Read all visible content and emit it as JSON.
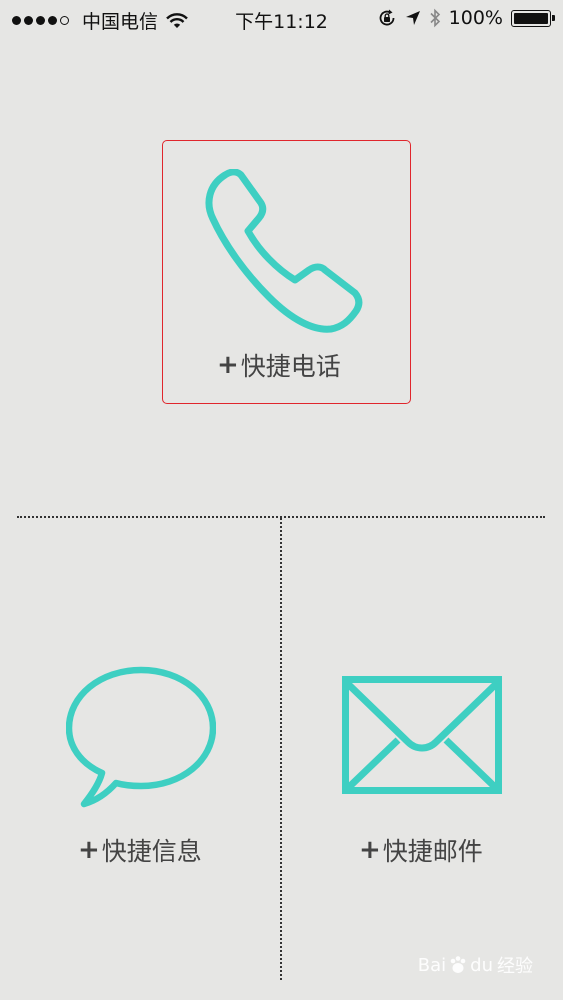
{
  "status_bar": {
    "carrier": "中国电信",
    "time": "下午11:12",
    "battery": "100%",
    "signal_bars": 4,
    "signal_total": 5,
    "battery_level": 1.0,
    "icons": [
      "wifi-icon",
      "rotation-lock-icon",
      "location-arrow-icon",
      "bluetooth-icon",
      "battery-icon"
    ]
  },
  "tiles": {
    "call": {
      "plus": "+",
      "label": "快捷电话",
      "icon": "phone-handset-icon"
    },
    "message": {
      "plus": "+",
      "label": "快捷信息",
      "icon": "speech-bubble-icon"
    },
    "mail": {
      "plus": "+",
      "label": "快捷邮件",
      "icon": "envelope-icon"
    }
  },
  "watermark": {
    "brand_left": "Bai",
    "brand_right": "du",
    "suffix": "经验",
    "url": "jingyan.baidu.com"
  },
  "colors": {
    "accent": "#3ecfc2",
    "background": "#e6e6e4",
    "selection_border": "#e0262c",
    "text": "#444444"
  }
}
